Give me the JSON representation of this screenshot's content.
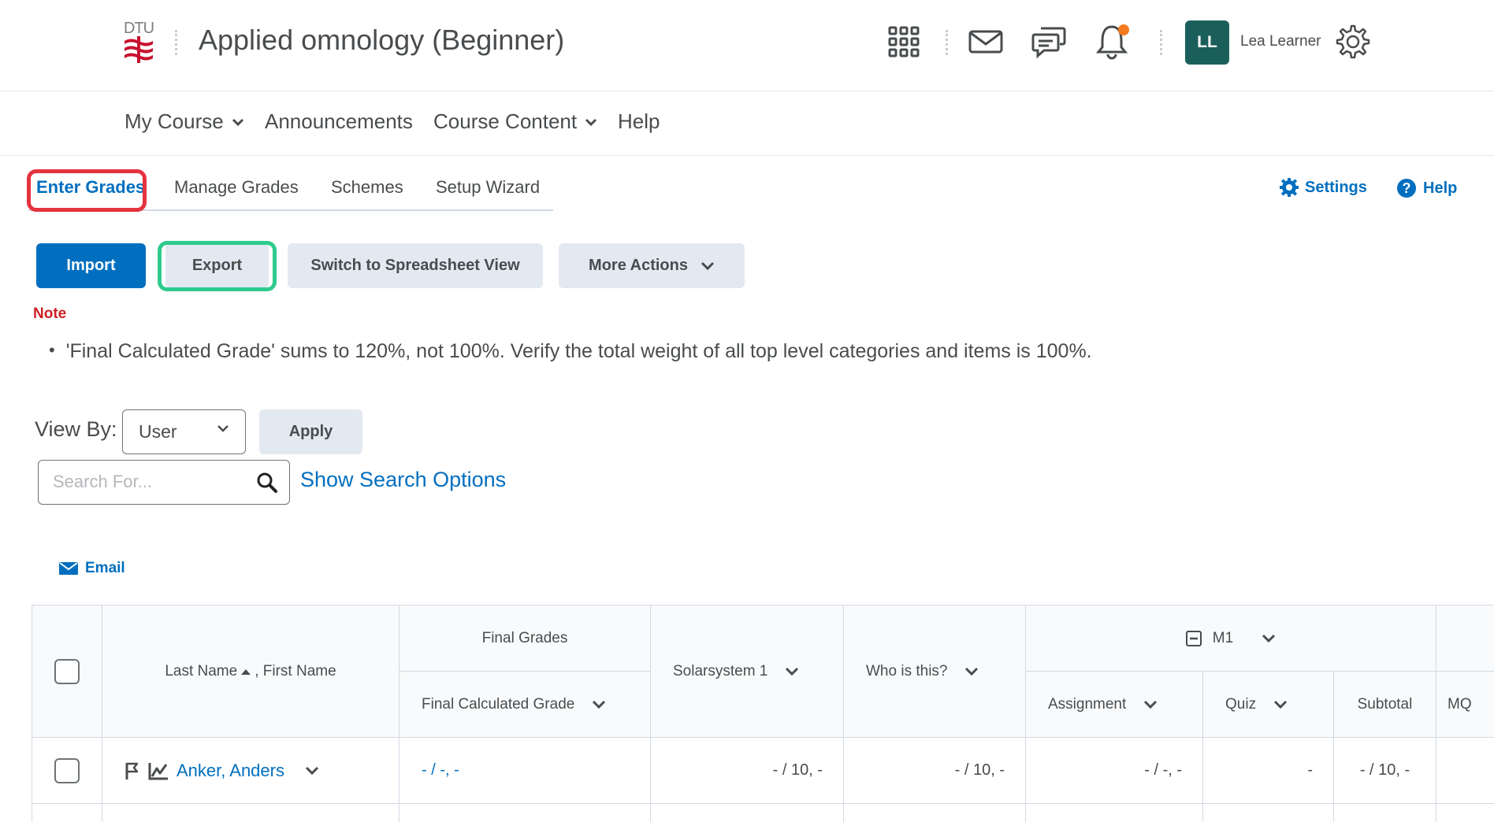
{
  "header": {
    "logo_text": "DTU",
    "course_title": "Applied omnology (Beginner)",
    "user_initials": "LL",
    "user_name": "Lea Learner",
    "icons": [
      "apps-grid-icon",
      "mail-icon",
      "chat-icon",
      "bell-icon",
      "gear-icon"
    ],
    "notification_dot_color": "#f47a1e"
  },
  "nav": {
    "items": [
      {
        "label": "My Course",
        "has_menu": true
      },
      {
        "label": "Announcements",
        "has_menu": false
      },
      {
        "label": "Course Content",
        "has_menu": true
      },
      {
        "label": "Help",
        "has_menu": false
      }
    ]
  },
  "tabs": [
    {
      "label": "Enter Grades",
      "active": true
    },
    {
      "label": "Manage Grades",
      "active": false
    },
    {
      "label": "Schemes",
      "active": false
    },
    {
      "label": "Setup Wizard",
      "active": false
    }
  ],
  "top_links": {
    "settings": "Settings",
    "help": "Help"
  },
  "toolbar": {
    "import": "Import",
    "export": "Export",
    "switch_view": "Switch to Spreadsheet View",
    "more_actions": "More Actions"
  },
  "note": {
    "label": "Note",
    "message": "'Final Calculated Grade' sums to 120%, not 100%. Verify the total weight of all top level categories and items is 100%."
  },
  "filters": {
    "view_by_label": "View By:",
    "view_by_value": "User",
    "apply": "Apply",
    "search_placeholder": "Search For...",
    "search_options": "Show Search Options",
    "email": "Email"
  },
  "grid": {
    "name_header": "Last Name",
    "name_header_suffix": ", First Name",
    "final_grades_group": "Final Grades",
    "final_calculated": "Final Calculated Grade",
    "solarsystem": "Solarsystem 1",
    "who_is_this": "Who is this?",
    "m1_group": "M1",
    "assignment": "Assignment",
    "quiz": "Quiz",
    "subtotal": "Subtotal",
    "mq": "MQ",
    "rows": [
      {
        "name": "Anker, Anders",
        "final_calculated": "- / -, -",
        "solarsystem": "- / 10, -",
        "who_is_this": "- / 10, -",
        "assignment": "- / -, -",
        "quiz": "-",
        "subtotal": "- / 10, -"
      }
    ]
  },
  "colors": {
    "primary": "#006fbf",
    "highlight_red": "#e4333f",
    "highlight_green": "#2ecb8e",
    "note_red": "#cd2026",
    "avatar_bg": "#1b5f5b"
  }
}
